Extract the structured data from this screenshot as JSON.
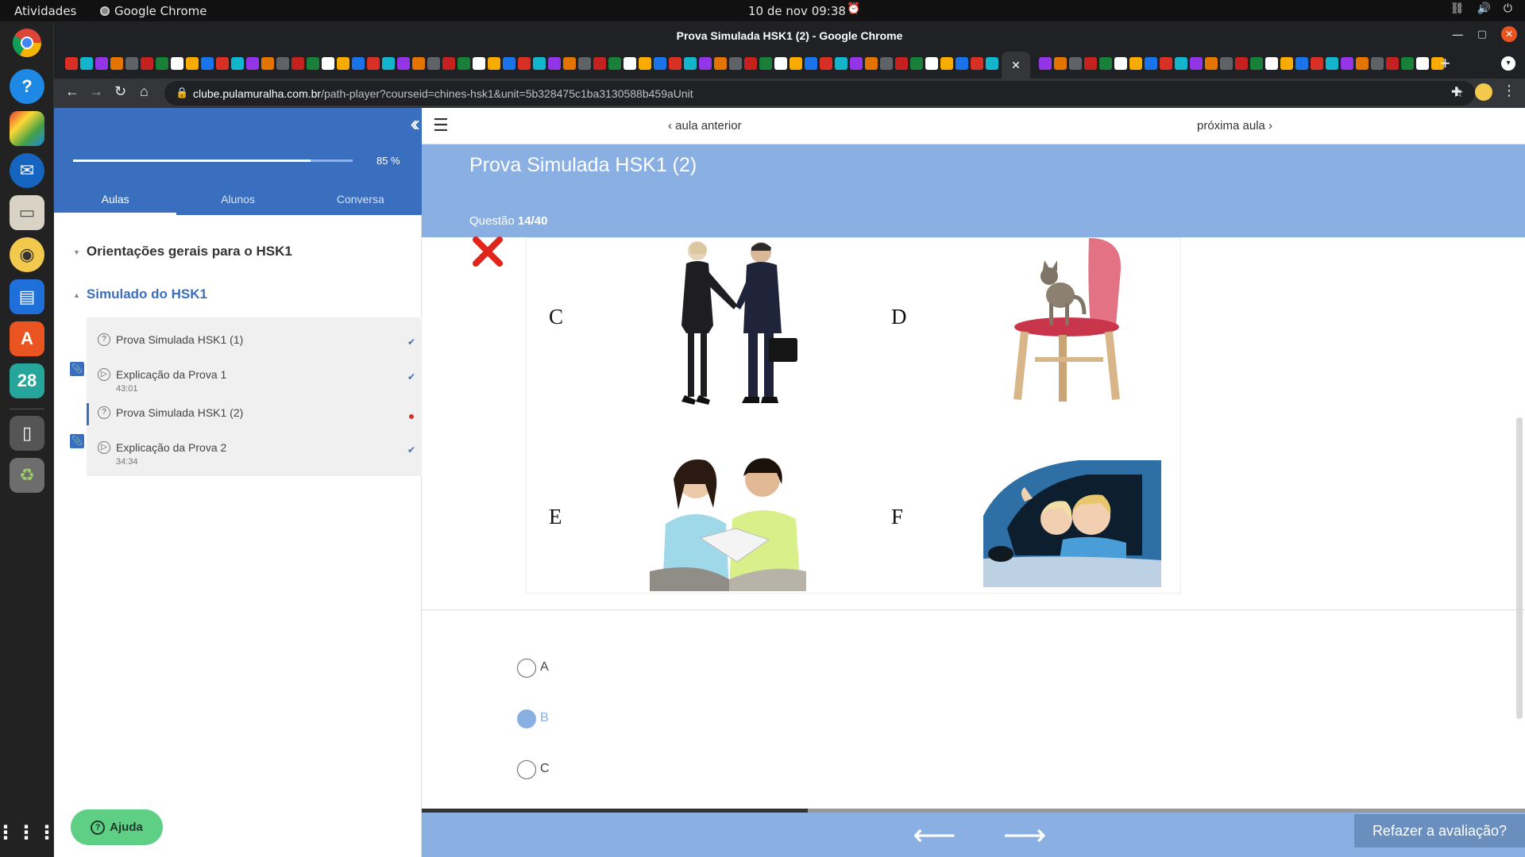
{
  "topbar": {
    "activities": "Atividades",
    "app_name": "Google Chrome",
    "clock": "10 de nov  09:38"
  },
  "dock": {
    "calendar_day": "28"
  },
  "chrome": {
    "window_title": "Prova Simulada HSK1 (2) - Google Chrome",
    "url_host": "clube.pulamuralha.com.br",
    "url_path": "/path-player?courseid=chines-hsk1&unit=5b328475c1ba3130588b459aUnit"
  },
  "sidebar": {
    "progress_label": "85 %",
    "progress": 0.85,
    "tabs": [
      "Aulas",
      "Alunos",
      "Conversa"
    ],
    "sections": [
      {
        "title": "Orientações gerais para o HSK1"
      },
      {
        "title": "Simulado do HSK1"
      }
    ],
    "lessons": [
      {
        "title": "Prova Simulada HSK1 (1)",
        "duration": ""
      },
      {
        "title": "Explicação da Prova 1",
        "duration": "43:01"
      },
      {
        "title": "Prova Simulada HSK1 (2)",
        "duration": ""
      },
      {
        "title": "Explicação da Prova 2",
        "duration": "34:34"
      }
    ],
    "help_label": "Ajuda"
  },
  "main": {
    "prev_label": "aula anterior",
    "next_label": "próxima aula",
    "title": "Prova Simulada HSK1 (2)",
    "question_prefix": "Questão ",
    "question_number": "14/40",
    "image_letters": [
      "C",
      "D",
      "E",
      "F"
    ],
    "options": [
      "A",
      "B",
      "C"
    ],
    "selected_option": "B",
    "progress": 0.35,
    "redo_label": "Refazer a avaliação?"
  }
}
